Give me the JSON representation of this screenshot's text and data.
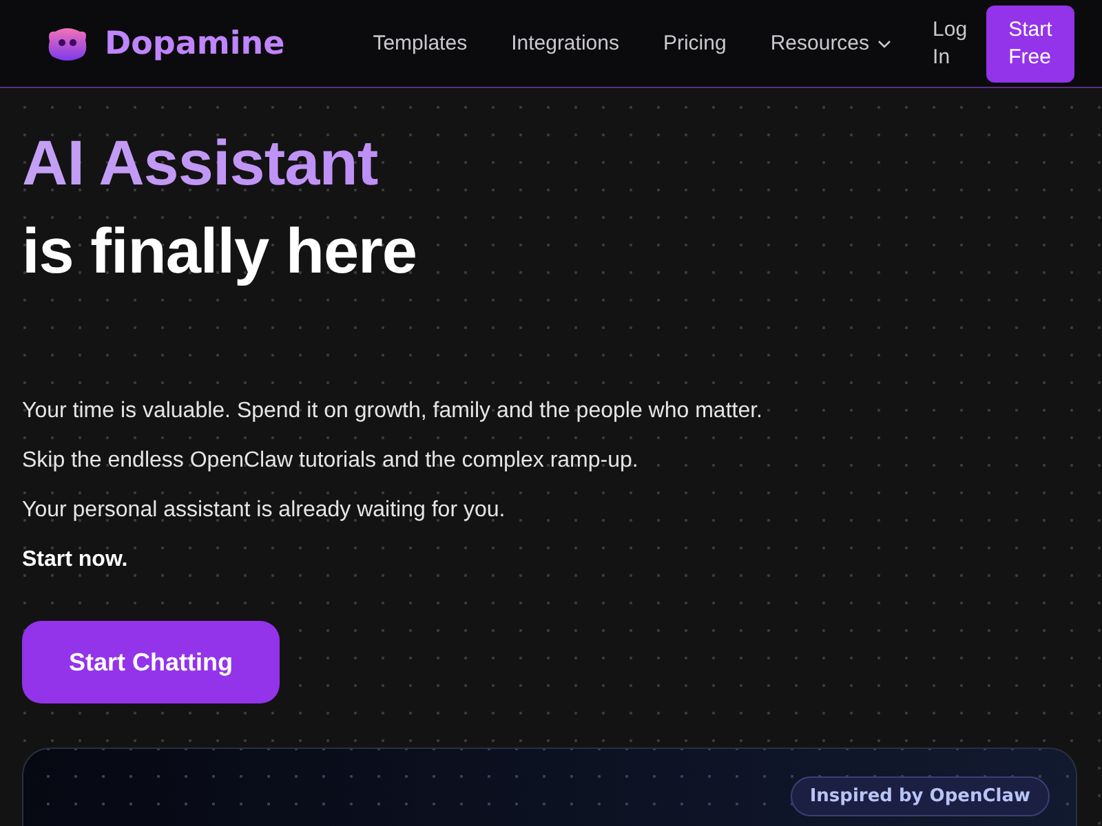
{
  "header": {
    "logo_text": "Dopamine",
    "nav": [
      {
        "label": "Templates",
        "kind": "link"
      },
      {
        "label": "Integrations",
        "kind": "link"
      },
      {
        "label": "Pricing",
        "kind": "link"
      },
      {
        "label": "Resources",
        "kind": "dropdown"
      }
    ],
    "login": "Log In",
    "cta": "Start Free"
  },
  "hero": {
    "heading_lines": [
      {
        "text": "AI Assistant",
        "kind": "accent"
      },
      {
        "text": "is finally here",
        "kind": "plain"
      }
    ],
    "paragraphs": [
      {
        "text": "Your time is valuable. Spend it on growth, family and the people who matter.",
        "kind": "normal"
      },
      {
        "text": "Skip the endless OpenClaw tutorials and the complex ramp-up.",
        "kind": "normal"
      },
      {
        "text": "Your personal assistant is already waiting for you.",
        "kind": "normal"
      },
      {
        "text": "Start now.",
        "kind": "bold"
      }
    ],
    "button": "Start Chatting"
  },
  "card": {
    "badge": "Inspired by OpenClaw"
  }
}
